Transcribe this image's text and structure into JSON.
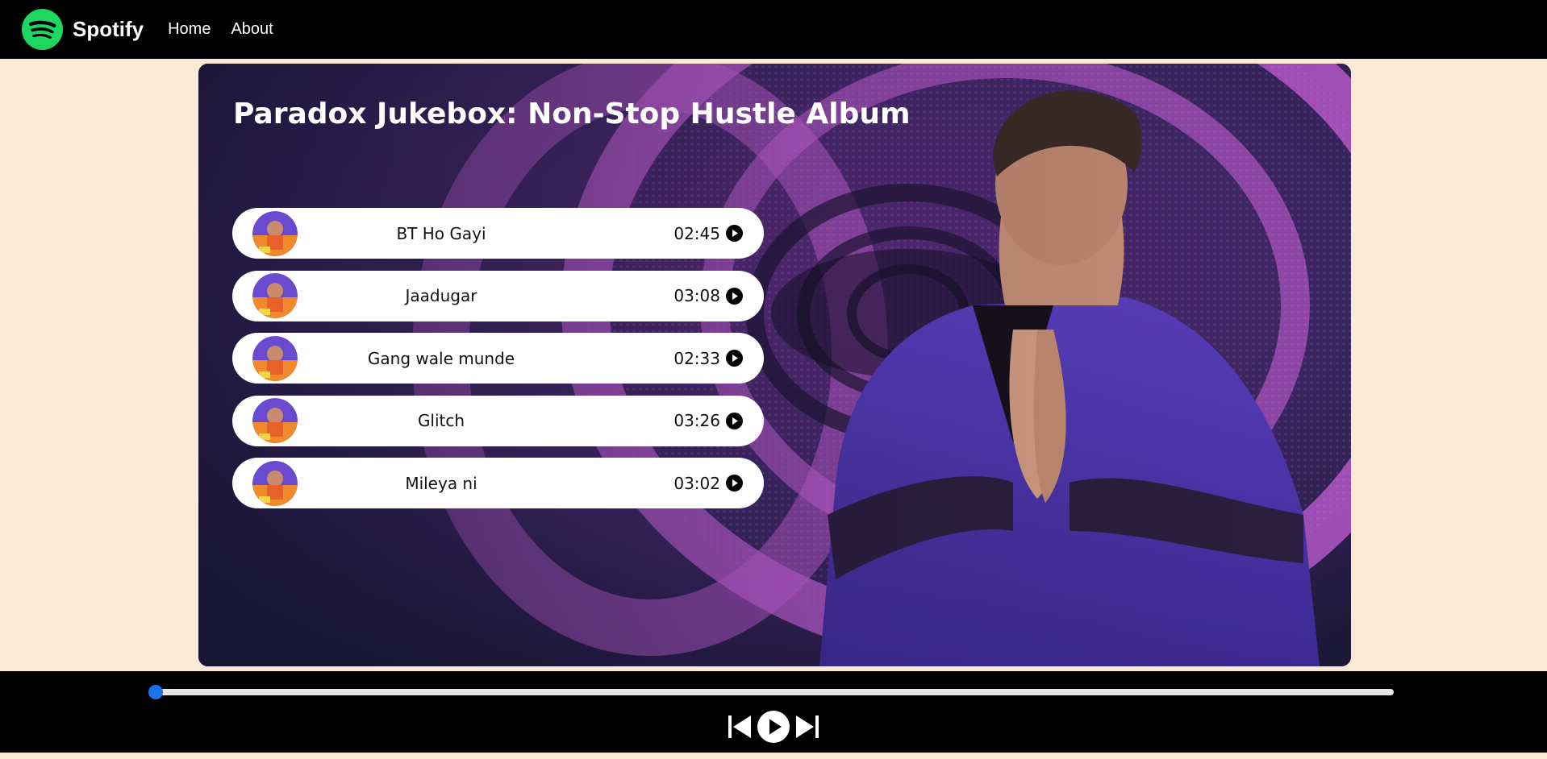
{
  "brand": {
    "name": "Spotify",
    "logo_icon": "spotify-logo-icon",
    "logo_color": "#1ed760"
  },
  "nav": {
    "items": [
      {
        "label": "Home"
      },
      {
        "label": "About"
      }
    ]
  },
  "album": {
    "title": "Paradox Jukebox: Non-Stop Hustle Album",
    "background_image": "artist-photo-purple-stage"
  },
  "songs": [
    {
      "name": "BT Ho Gayi",
      "duration": "02:45",
      "cover_icon": "album-cover-thumbnail",
      "action_icon": "play-circle-icon"
    },
    {
      "name": "Jaadugar",
      "duration": "03:08",
      "cover_icon": "album-cover-thumbnail",
      "action_icon": "play-circle-icon"
    },
    {
      "name": "Gang wale munde",
      "duration": "02:33",
      "cover_icon": "album-cover-thumbnail",
      "action_icon": "play-circle-icon"
    },
    {
      "name": "Glitch",
      "duration": "03:26",
      "cover_icon": "album-cover-thumbnail",
      "action_icon": "play-circle-icon"
    },
    {
      "name": "Mileya ni",
      "duration": "03:02",
      "cover_icon": "album-cover-thumbnail",
      "action_icon": "play-circle-icon"
    }
  ],
  "player": {
    "progress_percent": 0,
    "progress_color": "#1a73e8",
    "controls": [
      {
        "icon": "previous-track-icon"
      },
      {
        "icon": "play-icon"
      },
      {
        "icon": "next-track-icon"
      }
    ]
  },
  "colors": {
    "page_background": "#f9ead6",
    "bars": "#000000",
    "accent": "#1ed760"
  }
}
